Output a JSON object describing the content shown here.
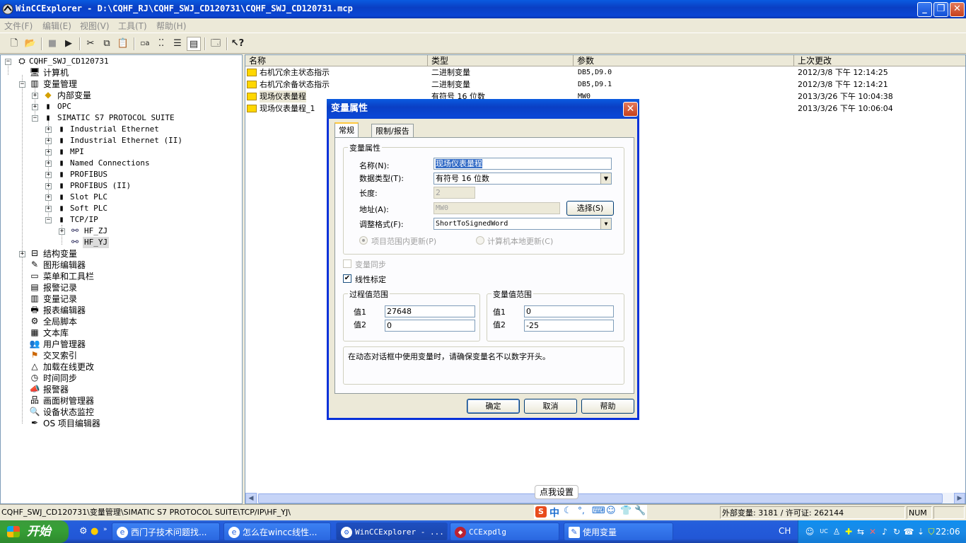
{
  "window": {
    "title": "WinCCExplorer - D:\\CQHF_RJ\\CQHF_SWJ_CD120731\\CQHF_SWJ_CD120731.mcp"
  },
  "menu": [
    {
      "label": "文件(F)"
    },
    {
      "label": "编辑(E)"
    },
    {
      "label": "视图(V)"
    },
    {
      "label": "工具(T)"
    },
    {
      "label": "帮助(H)"
    }
  ],
  "tree": {
    "root": "CQHF_SWJ_CD120731",
    "items": [
      {
        "label": "计算机"
      },
      {
        "label": "变量管理"
      },
      {
        "label": "内部变量"
      },
      {
        "label": "OPC"
      },
      {
        "label": "SIMATIC S7 PROTOCOL SUITE"
      },
      {
        "label": "Industrial Ethernet"
      },
      {
        "label": "Industrial Ethernet (II)"
      },
      {
        "label": "MPI"
      },
      {
        "label": "Named Connections"
      },
      {
        "label": "PROFIBUS"
      },
      {
        "label": "PROFIBUS (II)"
      },
      {
        "label": "Slot PLC"
      },
      {
        "label": "Soft PLC"
      },
      {
        "label": "TCP/IP"
      },
      {
        "label": "HF_ZJ"
      },
      {
        "label": "HF_YJ"
      },
      {
        "label": "结构变量"
      },
      {
        "label": "图形编辑器"
      },
      {
        "label": "菜单和工具栏"
      },
      {
        "label": "报警记录"
      },
      {
        "label": "变量记录"
      },
      {
        "label": "报表编辑器"
      },
      {
        "label": "全局脚本"
      },
      {
        "label": "文本库"
      },
      {
        "label": "用户管理器"
      },
      {
        "label": "交叉索引"
      },
      {
        "label": "加载在线更改"
      },
      {
        "label": "时间同步"
      },
      {
        "label": "报警器"
      },
      {
        "label": "画面树管理器"
      },
      {
        "label": "设备状态监控"
      },
      {
        "label": "OS 项目编辑器"
      }
    ]
  },
  "list": {
    "columns": [
      "名称",
      "类型",
      "参数",
      "上次更改"
    ],
    "rows": [
      {
        "name": "右机冗余主状态指示",
        "type": "二进制变量",
        "param": "DB5,D9.0",
        "changed": "2012/3/8 下午 12:14:25"
      },
      {
        "name": "右机冗余备状态指示",
        "type": "二进制变量",
        "param": "DB5,D9.1",
        "changed": "2012/3/8 下午 12:14:21"
      },
      {
        "name": "现场仪表量程",
        "type": "有符号 16 位数",
        "param": "MW0",
        "changed": "2013/3/26 下午 10:04:38"
      },
      {
        "name": "现场仪表量程_1",
        "type": "",
        "param": "",
        "changed": "2013/3/26 下午 10:06:04"
      }
    ]
  },
  "dialog": {
    "title": "变量属性",
    "tabs": [
      "常规",
      "限制/报告"
    ],
    "group_props": "变量属性",
    "name_label": "名称(N):",
    "name_value": "现场仪表量程",
    "type_label": "数据类型(T):",
    "type_value": "有符号 16 位数",
    "length_label": "长度:",
    "length_value": "2",
    "address_label": "地址(A):",
    "address_value": "MW0",
    "select_button": "选择(S)",
    "format_label": "调整格式(F):",
    "format_value": "ShortToSignedWord",
    "radio_project": "项目范围内更新(P)",
    "radio_local": "计算机本地更新(C)",
    "sync_label": "变量同步",
    "linear_label": "线性标定",
    "linear_checked": true,
    "process_group": "过程值范围",
    "tag_group": "变量值范围",
    "value1_label": "值1",
    "value2_label": "值2",
    "process_v1": "27648",
    "process_v2": "0",
    "tag_v1": "0",
    "tag_v2": "-25",
    "info_text": "在动态对话框中使用变量时，请确保变量名不以数字开头。",
    "ok": "确定",
    "cancel": "取消",
    "help": "帮助"
  },
  "statusbar": {
    "path": "CQHF_SWJ_CD120731\\变量管理\\SIMATIC S7 PROTOCOL SUITE\\TCP/IP\\HF_YJ\\",
    "ime_tip": "点我设置",
    "ime_mode": "中",
    "counts": "外部变量: 3181 / 许可证: 262144",
    "num": "NUM"
  },
  "taskbar": {
    "start": "开始",
    "tasks": [
      {
        "label": "西门子技术问题找..."
      },
      {
        "label": "怎么在wincc线性..."
      },
      {
        "label": "WinCCExplorer - ..."
      },
      {
        "label": "CCExpdlg"
      },
      {
        "label": "使用变量"
      }
    ],
    "lang": "CH",
    "clock": "22:06"
  }
}
